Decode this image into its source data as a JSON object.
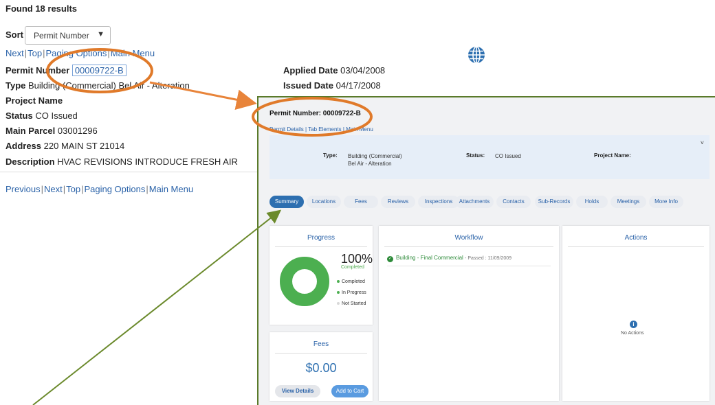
{
  "results": {
    "found_text": "Found 18 results"
  },
  "sort": {
    "label": "Sort",
    "selected": "Permit Number"
  },
  "nav_top": [
    "Next",
    "Top",
    "Paging Options",
    "Main Menu"
  ],
  "nav_bottom": [
    "Previous",
    "Next",
    "Top",
    "Paging Options",
    "Main Menu"
  ],
  "record": {
    "permit_number_label": "Permit Number",
    "permit_number": "00009722-B",
    "type_label": "Type",
    "type": "Building (Commercial) Bel Air - Alteration",
    "project_name_label": "Project Name",
    "status_label": "Status",
    "status": "CO Issued",
    "main_parcel_label": "Main Parcel",
    "main_parcel": "03001296",
    "address_label": "Address",
    "address": "220 MAIN ST 21014",
    "description_label": "Description",
    "description": "HVAC REVISIONS INTRODUCE FRESH AIR",
    "applied_date_label": "Applied Date",
    "applied_date": "03/04/2008",
    "issued_date_label": "Issued Date",
    "issued_date": "04/17/2008"
  },
  "detail": {
    "title": "Permit Number: 00009722-B",
    "links": [
      "Permit Details",
      "Tab Elements",
      "Main Menu"
    ],
    "info": {
      "type_label": "Type:",
      "type_line1": "Building (Commercial)",
      "type_line2": "Bel Air - Alteration",
      "status_label": "Status:",
      "status": "CO Issued",
      "project_label": "Project Name:"
    },
    "tabs": [
      "Summary",
      "Locations",
      "Fees",
      "Reviews",
      "Inspections",
      "Attachments",
      "Contacts",
      "Sub-Records",
      "Holds",
      "Meetings",
      "More Info"
    ],
    "active_tab": "Summary",
    "progress": {
      "title": "Progress",
      "percent_text": "100%",
      "percent": 100,
      "sub": "Completed",
      "legend": [
        "Completed",
        "In Progress",
        "Not Started"
      ]
    },
    "workflow": {
      "title": "Workflow",
      "item": "Building - Final Commercial",
      "item_meta": "- Passed : 11/09/2009"
    },
    "actions": {
      "title": "Actions",
      "empty": "No Actions"
    },
    "fees": {
      "title": "Fees",
      "amount": "$0.00",
      "view_details": "View Details",
      "add_to_cart": "Add to Cart"
    }
  },
  "colors": {
    "link": "#2a62a8",
    "accent": "#2d6fb0",
    "progress_green": "#4caf50",
    "annotation_orange": "#e07a2a",
    "annotation_green": "#6b8a2c"
  }
}
